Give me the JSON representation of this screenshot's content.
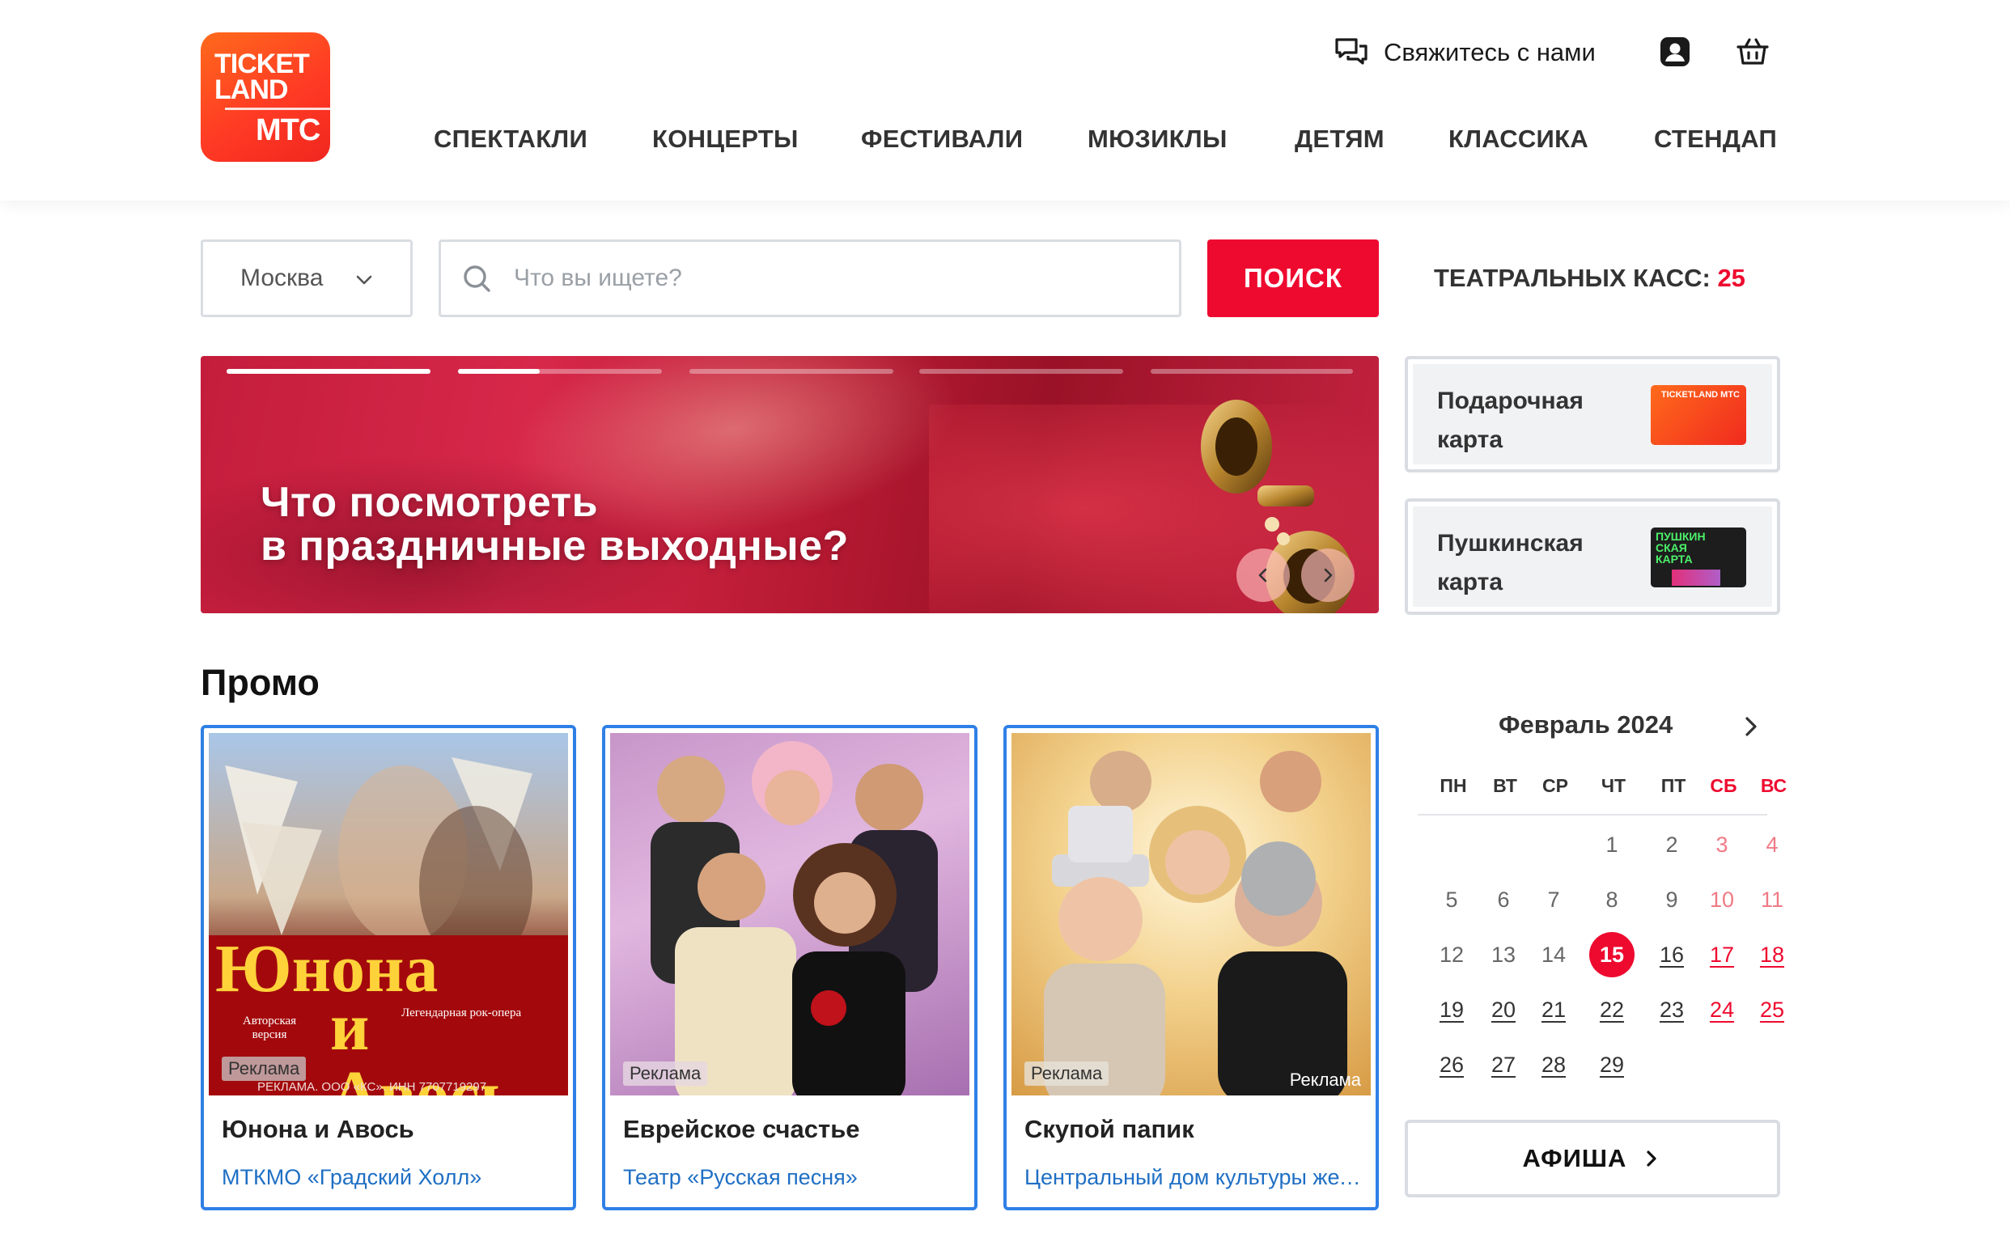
{
  "header": {
    "logo": {
      "line1": "TICKET",
      "line2": "LAND",
      "line3": "МТС"
    },
    "contact_label": "Свяжитесь с нами",
    "icons": {
      "contact": "chat-bubbles-icon",
      "profile": "user-profile-icon",
      "cart": "basket-icon"
    },
    "nav": [
      "СПЕКТАКЛИ",
      "КОНЦЕРТЫ",
      "ФЕСТИВАЛИ",
      "МЮЗИКЛЫ",
      "ДЕТЯМ",
      "КЛАССИКА",
      "СТЕНДАП"
    ]
  },
  "search": {
    "city": "Москва",
    "placeholder": "Что вы ищете?",
    "button_label": "ПОИСК",
    "box_office_label": "ТЕАТРАЛЬНЫХ КАСС:",
    "box_office_count": "25"
  },
  "banner": {
    "line1": "Что посмотреть",
    "line2": "в праздничные выходные?",
    "slides": 5,
    "slide_progress": [
      1,
      0.4,
      0,
      0,
      0
    ]
  },
  "side_cards": [
    {
      "title": "Подарочная карта",
      "thumb_label": "TICKETLAND МТС"
    },
    {
      "title": "Пушкинская карта",
      "thumb_label": "ПУШКИН СКАЯ КАРТА"
    }
  ],
  "promo": {
    "title": "Промо",
    "ad_label": "Реклама",
    "cards": [
      {
        "name": "Юнона и Авось",
        "venue": "МТКМО «Градский Холл»",
        "poster_title1": "Юнона",
        "poster_title2": "и Авось",
        "poster_sub1": "Авторская версия",
        "poster_sub2": "Легендарная рок-опера",
        "poster_legal": "РЕКЛАМА. ООО «КС». ИНН 7707719297"
      },
      {
        "name": "Еврейское счастье",
        "venue": "Театр «Русская песня»"
      },
      {
        "name": "Скупой папик",
        "venue": "Центральный дом культуры железнодорожников"
      }
    ]
  },
  "calendar": {
    "month": "Февраль 2024",
    "weekdays": [
      "ПН",
      "ВТ",
      "СР",
      "ЧТ",
      "ПТ",
      "СБ",
      "ВС"
    ],
    "first_weekday_index": 3,
    "days_in_month": 29,
    "today": 15,
    "colors": {
      "weekend_past": "#f07a86",
      "weekend_active": "#ee0a2f",
      "today_bg": "#ee0a2f"
    },
    "afisha_label": "АФИША"
  },
  "colors": {
    "accent": "#ee0a2f",
    "link": "#1f6fc4",
    "card_border": "#2f80e6"
  }
}
